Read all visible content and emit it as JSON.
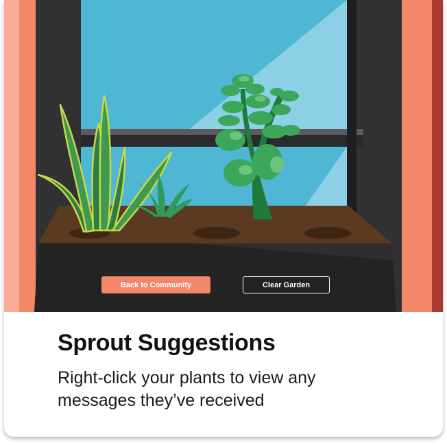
{
  "scene": {
    "buttons": {
      "community_label": "Back to Community",
      "clear_label": "Clear Garden"
    }
  },
  "footer": {
    "title": "Sprout Suggestions",
    "subtitle": "Right-click your plants to view any messages they’ve received"
  },
  "colors": {
    "accent": "#f2876a",
    "wall_light": "#f9ad98",
    "wall_dark": "#a9382f",
    "window_dark": "#313134",
    "sky": "#4fb7d3",
    "soil": "#5a3a21",
    "planter": "#232323"
  },
  "icons": [
    "snake-plant",
    "aloe-plant",
    "jade-plant"
  ]
}
